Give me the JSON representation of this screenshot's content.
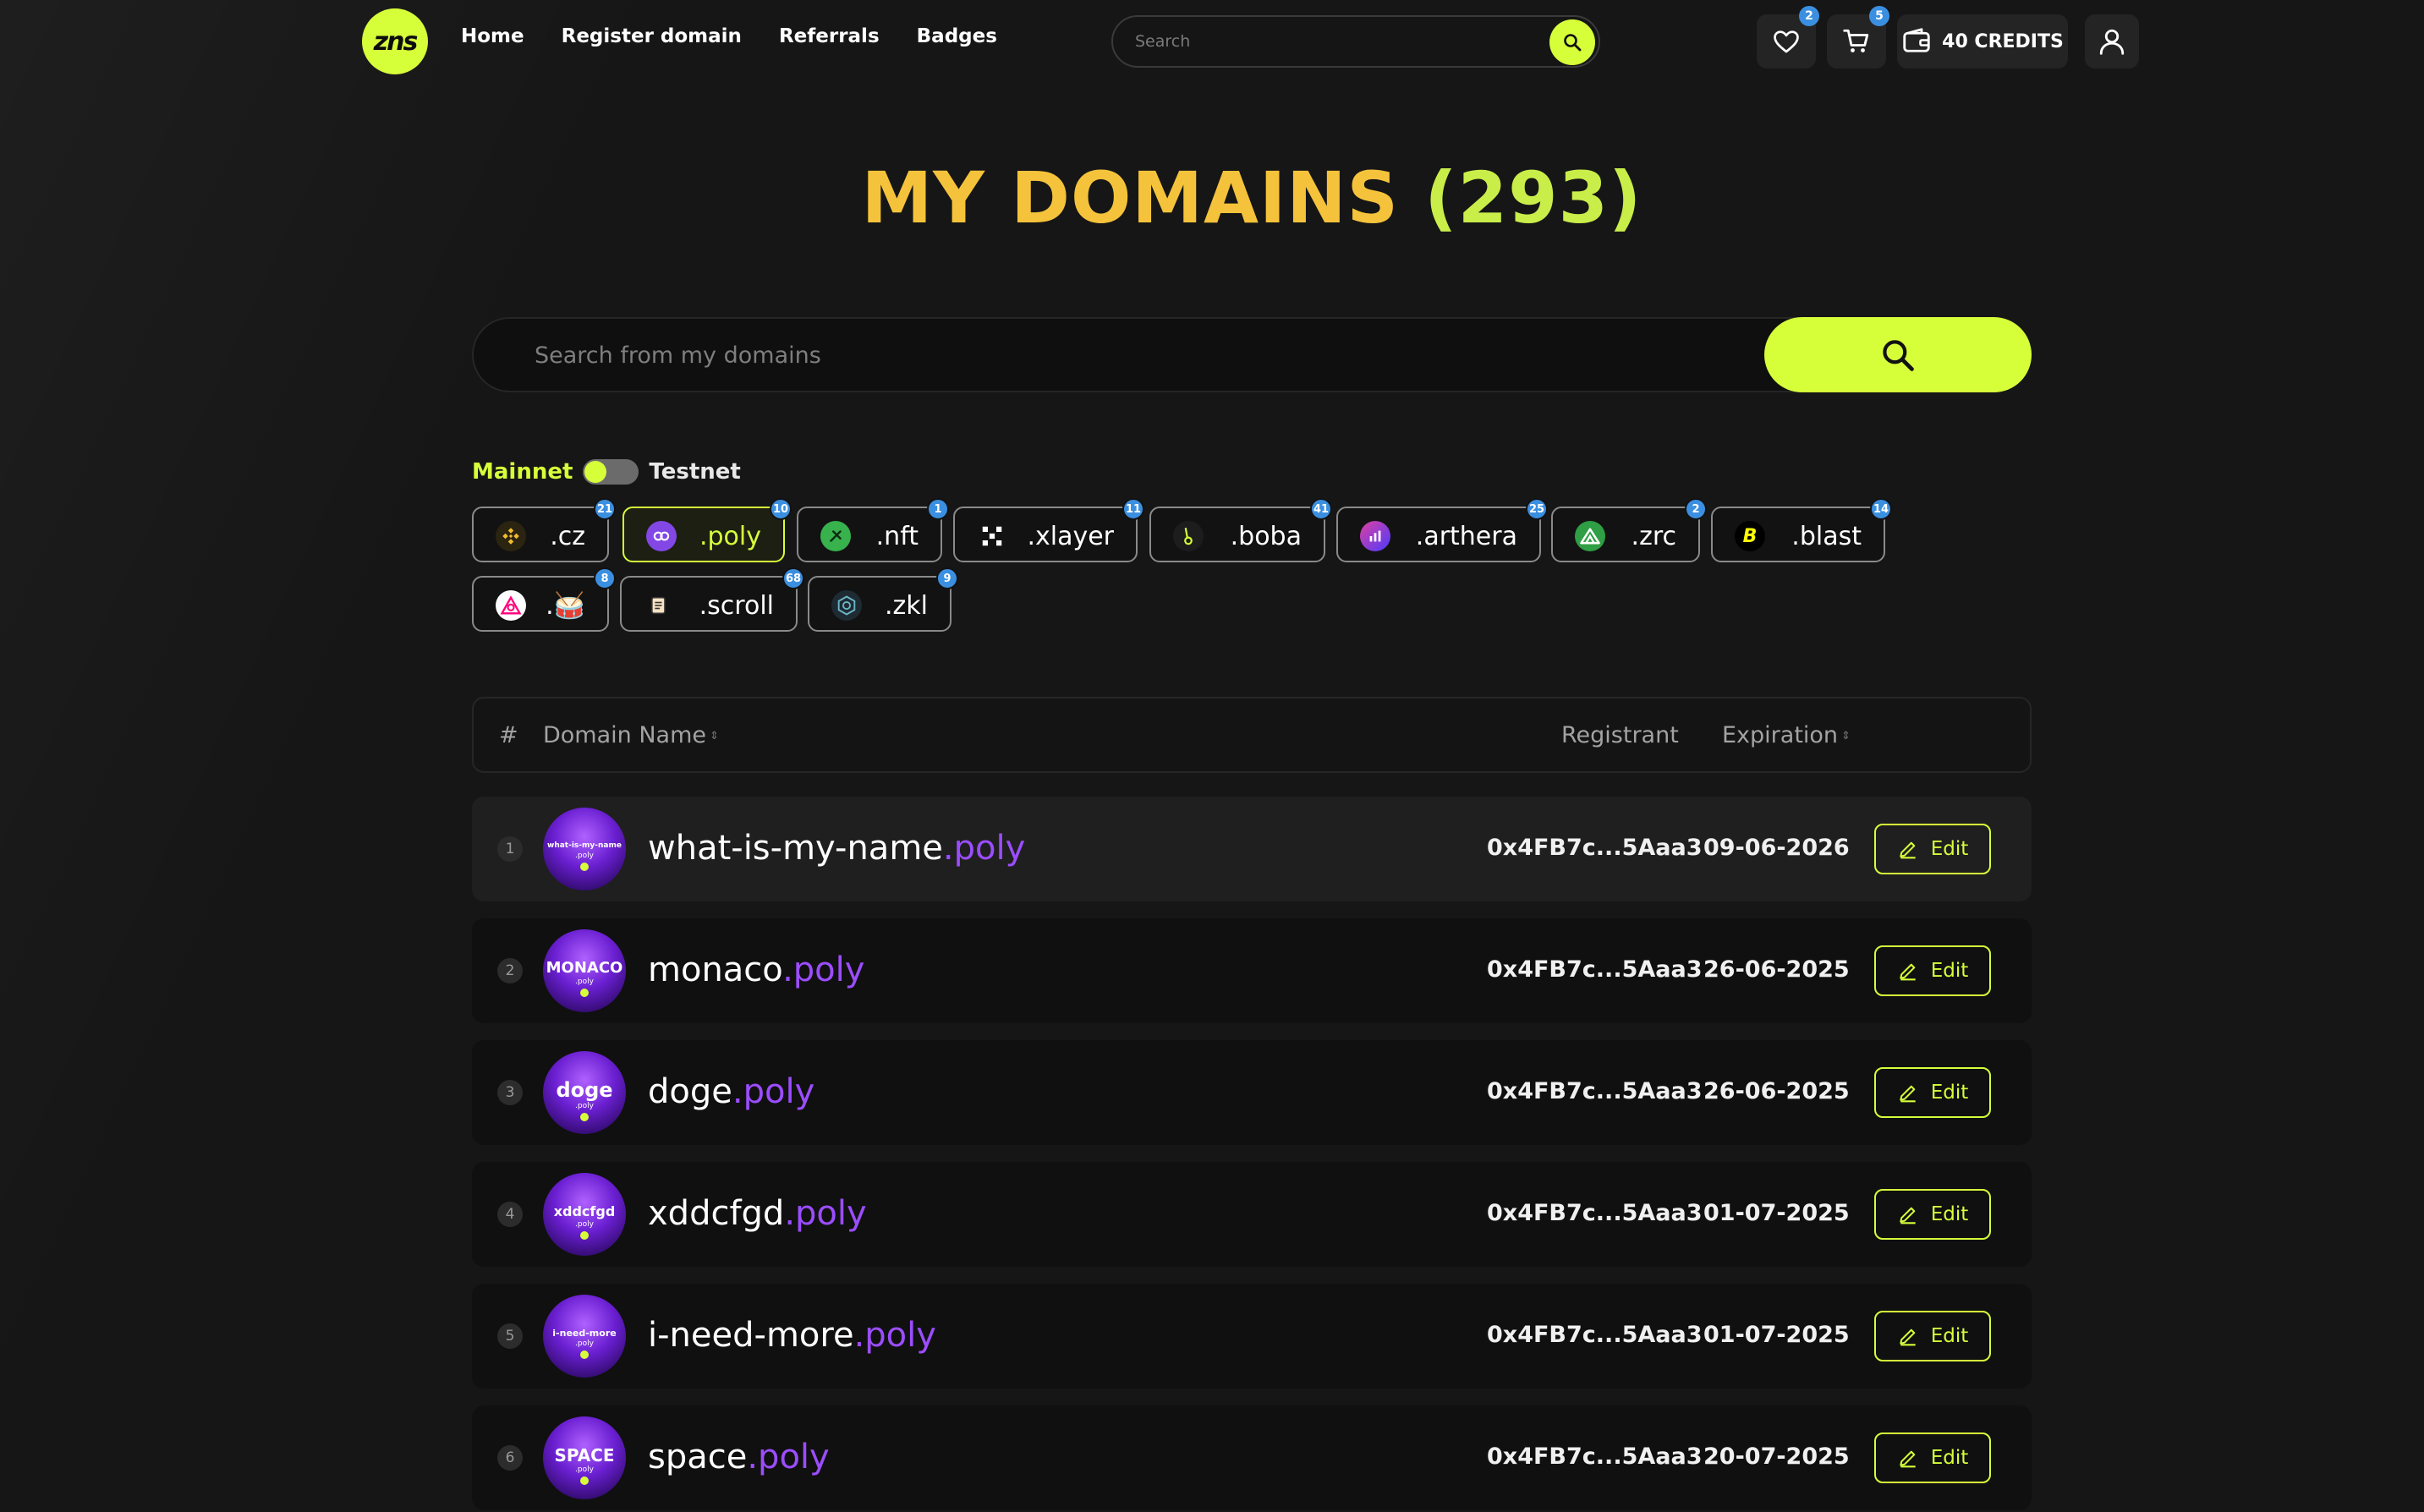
{
  "header": {
    "logo_text": "zns",
    "nav": [
      "Home",
      "Register domain",
      "Referrals",
      "Badges"
    ],
    "search_placeholder": "Search",
    "favorites_count": "2",
    "cart_count": "5",
    "credits_label": "40 CREDITS"
  },
  "page": {
    "title_main": "MY DOMAINS",
    "title_count": "(293)",
    "search_placeholder": "Search from my domains"
  },
  "network": {
    "mainnet_label": "Mainnet",
    "testnet_label": "Testnet",
    "selected": "Mainnet"
  },
  "tlds": [
    {
      "label": ".cz",
      "count": "21",
      "icon": "bnb-icon",
      "active": false
    },
    {
      "label": ".poly",
      "count": "10",
      "icon": "polygon-icon",
      "active": true
    },
    {
      "label": ".nft",
      "count": "1",
      "icon": "nft-icon",
      "active": false
    },
    {
      "label": ".xlayer",
      "count": "11",
      "icon": "xlayer-icon",
      "active": false
    },
    {
      "label": ".boba",
      "count": "41",
      "icon": "boba-icon",
      "active": false
    },
    {
      "label": ".arthera",
      "count": "25",
      "icon": "arthera-icon",
      "active": false
    },
    {
      "label": ".zrc",
      "count": "2",
      "icon": "zrc-icon",
      "active": false
    },
    {
      "label": ".blast",
      "count": "14",
      "icon": "blast-icon",
      "active": false
    },
    {
      "label": ".🥁",
      "count": "8",
      "icon": "drum-icon",
      "active": false
    },
    {
      "label": ".scroll",
      "count": "68",
      "icon": "scroll-icon",
      "active": false
    },
    {
      "label": ".zkl",
      "count": "9",
      "icon": "zkl-icon",
      "active": false
    }
  ],
  "table": {
    "headers": {
      "index": "#",
      "name": "Domain Name",
      "registrant": "Registrant",
      "expiration": "Expiration"
    },
    "edit_label": "Edit",
    "rows": [
      {
        "num": "1",
        "name": "what-is-my-name",
        "tld": ".poly",
        "avatar_text": "what-is-my-name",
        "avatar_tld": ".poly",
        "registrant": "0x4FB7c...5Aaa3",
        "expiration": "09-06-2026"
      },
      {
        "num": "2",
        "name": "monaco",
        "tld": ".poly",
        "avatar_text": "MONACO",
        "avatar_tld": ".poly",
        "registrant": "0x4FB7c...5Aaa3",
        "expiration": "26-06-2025"
      },
      {
        "num": "3",
        "name": "doge",
        "tld": ".poly",
        "avatar_text": "doge",
        "avatar_tld": ".poly",
        "registrant": "0x4FB7c...5Aaa3",
        "expiration": "26-06-2025"
      },
      {
        "num": "4",
        "name": "xddcfgd",
        "tld": ".poly",
        "avatar_text": "xddcfgd",
        "avatar_tld": ".poly",
        "registrant": "0x4FB7c...5Aaa3",
        "expiration": "01-07-2025"
      },
      {
        "num": "5",
        "name": "i-need-more",
        "tld": ".poly",
        "avatar_text": "i-need-more",
        "avatar_tld": ".poly",
        "registrant": "0x4FB7c...5Aaa3",
        "expiration": "01-07-2025"
      },
      {
        "num": "6",
        "name": "space",
        "tld": ".poly",
        "avatar_text": "SPACE",
        "avatar_tld": ".poly",
        "registrant": "0x4FB7c...5Aaa3",
        "expiration": "20-07-2025"
      }
    ]
  },
  "colors": {
    "accent": "#d6ff3a",
    "title_yellow": "#f5c33b",
    "tld_purple": "#9b4dff",
    "badge_blue": "#3b8fe0"
  }
}
